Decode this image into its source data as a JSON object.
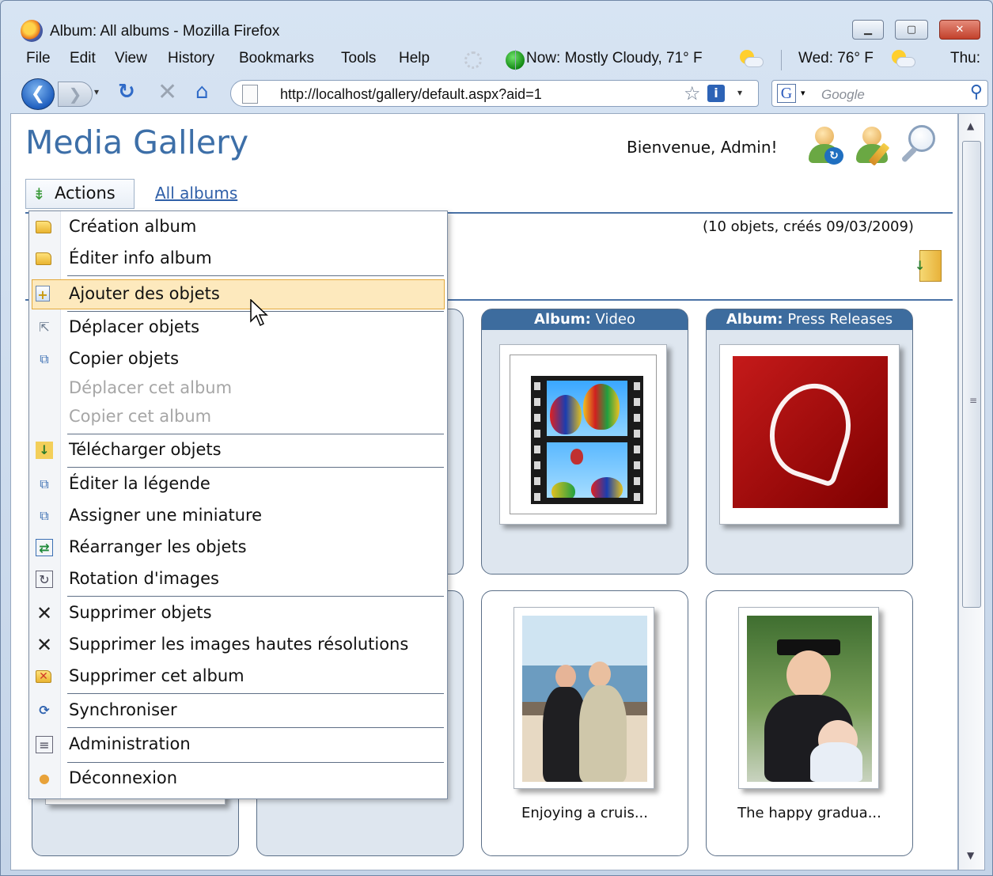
{
  "window": {
    "title": "Album: All albums - Mozilla Firefox",
    "min_glyph": "▁",
    "max_glyph": "▢",
    "close_glyph": "✕"
  },
  "menubar": {
    "items": [
      "File",
      "Edit",
      "View",
      "History",
      "Bookmarks",
      "Tools",
      "Help"
    ],
    "weather_now": "Now: Mostly Cloudy, 71° F",
    "weather_wed": "Wed: 76° F",
    "weather_thu": "Thu:"
  },
  "navbar": {
    "url": "http://localhost/gallery/default.aspx?aid=1",
    "search_placeholder": "Google",
    "back_glyph": "❮",
    "fwd_glyph": "❯",
    "reload_glyph": "↻",
    "stop_glyph": "✕",
    "home_glyph": "⌂",
    "star_glyph": "☆",
    "info_glyph": "i",
    "dropdown_glyph": "▾",
    "google_glyph": "G",
    "search_glyph": "⚲"
  },
  "page": {
    "site_title": "Media Gallery",
    "welcome": "Bienvenue, Admin!",
    "actions_label": "Actions",
    "actions_glyph": "⇟",
    "crumb": "All albums",
    "album_meta": "(10 objets, créés 09/03/2009)",
    "download_glyph": "↓"
  },
  "menu": {
    "items": [
      {
        "label": "Création album",
        "icon": "folder-open-icon",
        "enabled": true
      },
      {
        "label": "Éditer info album",
        "icon": "folder-edit-icon",
        "enabled": true
      },
      {
        "label": "Ajouter des objets",
        "icon": "add-objects-icon",
        "enabled": true,
        "highlighted": true
      },
      {
        "label": "Déplacer objets",
        "icon": "move-cursor-icon",
        "enabled": true
      },
      {
        "label": "Copier objets",
        "icon": "copy-icon",
        "enabled": true
      },
      {
        "label": "Déplacer cet album",
        "icon": "",
        "enabled": false
      },
      {
        "label": "Copier cet album",
        "icon": "",
        "enabled": false
      },
      {
        "label": "Télécharger objets",
        "icon": "download-icon",
        "enabled": true
      },
      {
        "label": "Éditer la légende",
        "icon": "edit-caption-icon",
        "enabled": true
      },
      {
        "label": "Assigner une miniature",
        "icon": "thumbnail-icon",
        "enabled": true
      },
      {
        "label": "Réarranger les objets",
        "icon": "rearrange-icon",
        "enabled": true
      },
      {
        "label": "Rotation d'images",
        "icon": "rotate-icon",
        "enabled": true
      },
      {
        "label": "Supprimer objets",
        "icon": "delete-icon",
        "enabled": true
      },
      {
        "label": "Supprimer les images hautes résolutions",
        "icon": "delete-hires-icon",
        "enabled": true
      },
      {
        "label": "Supprimer cet album",
        "icon": "delete-album-icon",
        "enabled": true
      },
      {
        "label": "Synchroniser",
        "icon": "sync-icon",
        "enabled": true
      },
      {
        "label": "Administration",
        "icon": "admin-icon",
        "enabled": true
      },
      {
        "label": "Déconnexion",
        "icon": "logout-icon",
        "enabled": true
      }
    ],
    "glyphs": {
      "add": "+",
      "move": "⇱",
      "copy": "⧉",
      "download": "↓",
      "rearrange": "⇄",
      "rotate": "↻",
      "delete": "✕",
      "sync": "⟳",
      "admin": "≡",
      "logout": "●"
    }
  },
  "cards": [
    {
      "head_prefix": "Album:",
      "head_name": "Video"
    },
    {
      "head_prefix": "Album:",
      "head_name": "Press Releases"
    },
    {
      "caption": "Enjoying a cruis..."
    },
    {
      "caption": "The happy gradua..."
    }
  ],
  "scrollbar": {
    "grip": "≡",
    "up": "▲",
    "down": "▼"
  }
}
